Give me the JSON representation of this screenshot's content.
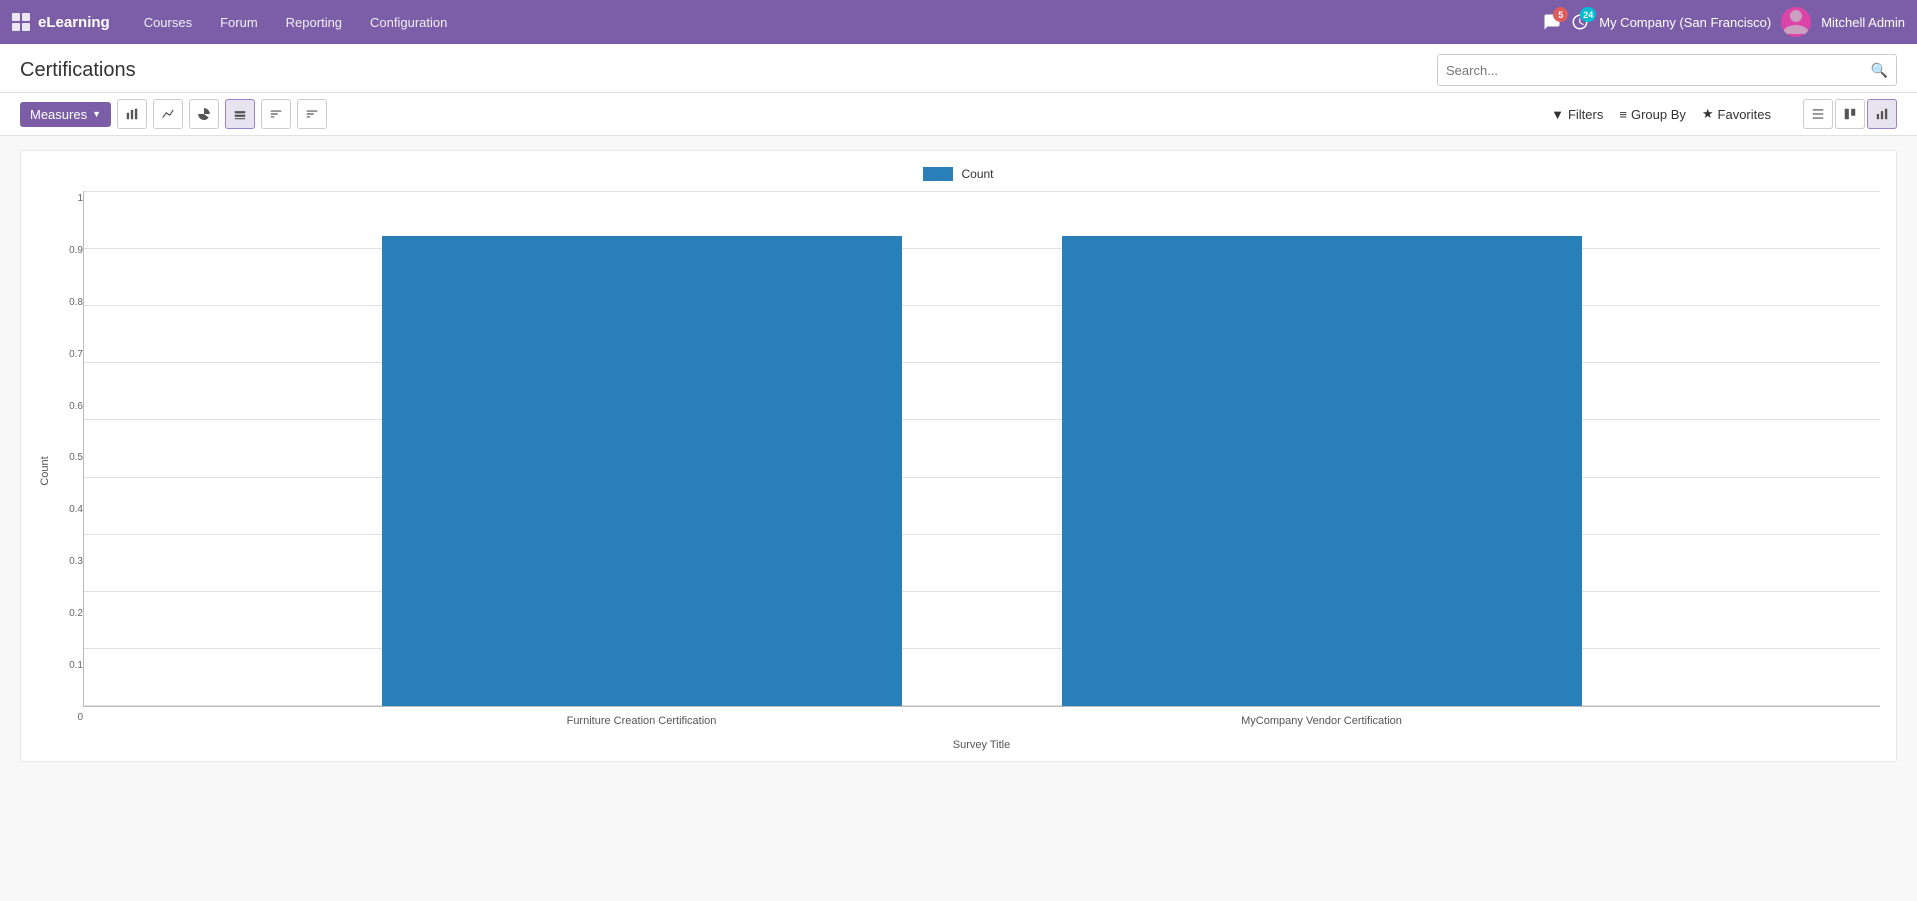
{
  "app": {
    "name": "eLearning",
    "company": "My Company (San Francisco)",
    "user": "Mitchell Admin"
  },
  "nav": {
    "links": [
      "Courses",
      "Forum",
      "Reporting",
      "Configuration"
    ]
  },
  "badges": {
    "chat": "5",
    "clock": "24"
  },
  "page": {
    "title": "Certifications",
    "search_placeholder": "Search..."
  },
  "toolbar": {
    "measures_label": "Measures",
    "chart_types": [
      "bar-chart",
      "line-chart",
      "pie-chart",
      "stacked-chart",
      "sort-asc",
      "sort-desc"
    ],
    "filters_label": "Filters",
    "groupby_label": "Group By",
    "favorites_label": "Favorites"
  },
  "chart": {
    "legend_label": "Count",
    "y_axis_label": "Count",
    "x_axis_label": "Survey Title",
    "y_ticks": [
      "1",
      "0.9",
      "0.8",
      "0.7",
      "0.6",
      "0.5",
      "0.4",
      "0.3",
      "0.2",
      "0.1",
      "0"
    ],
    "bars": [
      {
        "label": "Furniture Creation Certification",
        "value": 1,
        "color": "#2980B9"
      },
      {
        "label": "MyCompany Vendor Certification",
        "value": 1,
        "color": "#2980B9"
      }
    ],
    "bar_color": "#2980B9"
  },
  "view_icons": {
    "list": "list",
    "kanban": "kanban",
    "bar": "bar"
  }
}
